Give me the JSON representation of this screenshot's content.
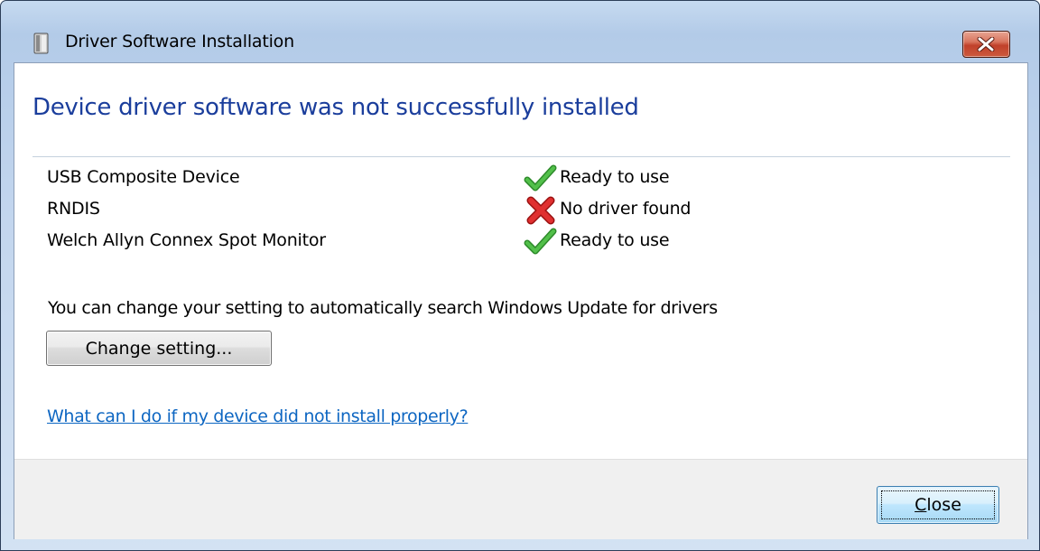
{
  "window": {
    "title": "Driver Software Installation",
    "title_icon": "usb-drive-icon",
    "close_icon": "close-icon"
  },
  "main": {
    "heading": "Device driver software was not successfully installed",
    "devices": [
      {
        "name": "USB Composite Device",
        "status": "Ready to use",
        "status_icon": "checkmark-icon"
      },
      {
        "name": "RNDIS",
        "status": "No driver found",
        "status_icon": "error-x-icon"
      },
      {
        "name": "Welch Allyn Connex Spot Monitor",
        "status": "Ready to use",
        "status_icon": "checkmark-icon"
      }
    ],
    "info_text": "You can change your setting to automatically search Windows Update for drivers",
    "change_button_label": "Change setting...",
    "help_link_text": "What can I do if my device did not install properly?"
  },
  "footer": {
    "close_button_mnemonic": "C",
    "close_button_rest": "lose"
  },
  "colors": {
    "heading": "#1b3e9c",
    "link": "#0d66c2",
    "success_green": "#3da33a",
    "error_red": "#d42020"
  }
}
